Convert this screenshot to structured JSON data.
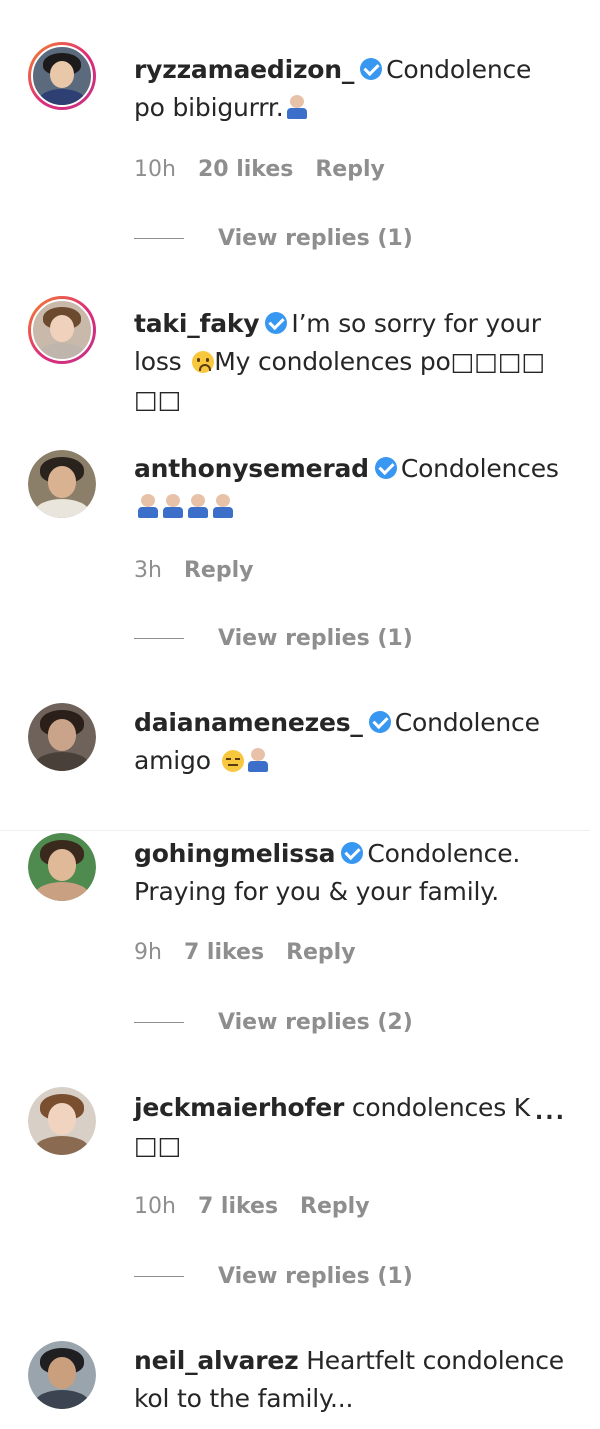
{
  "comments": [
    {
      "username": "ryzzamaedizon_",
      "text_line1": "Condolence",
      "text_line2": "po bibigurrr.",
      "time": "10h",
      "likes": "20 likes",
      "reply": "Reply",
      "view_replies": "View replies (1)"
    },
    {
      "username": "taki_faky",
      "text_line1": "I’m so sorry for your",
      "text_line2": "loss",
      "text_line2b": "My condolences po",
      "tofu_line2": "□□□□",
      "tofu_line3": "□□"
    },
    {
      "username": "anthonysemerad",
      "text_line1": "Condolences",
      "time": "3h",
      "reply": "Reply",
      "view_replies": "View replies (1)"
    },
    {
      "username": "daianamenezes_",
      "text_line1": "Condolence",
      "text_line2": "amigo"
    },
    {
      "username": "gohingmelissa",
      "text_line1": "Condolence.",
      "text_line2": "Praying for you & your family.",
      "time": "9h",
      "likes": "7 likes",
      "reply": "Reply",
      "view_replies": "View replies (2)"
    },
    {
      "username": "jeckmaierhofer",
      "text_line1": "condolences K",
      "tofu_line2": "□□",
      "more": "...",
      "time": "10h",
      "likes": "7 likes",
      "reply": "Reply",
      "view_replies": "View replies (1)"
    },
    {
      "username": "neil_alvarez",
      "text_line1": "Heartfelt condolence",
      "text_line2": "kol to the family..."
    }
  ],
  "colors": {
    "text": "#262626",
    "secondary": "#8e8e8e",
    "verified": "#3897f0",
    "story_ring": "#dd2a7b"
  },
  "icons": [
    "verified-badge-icon",
    "praying-hands-emoji",
    "sad-face-emoji",
    "winking-face-emoji"
  ]
}
